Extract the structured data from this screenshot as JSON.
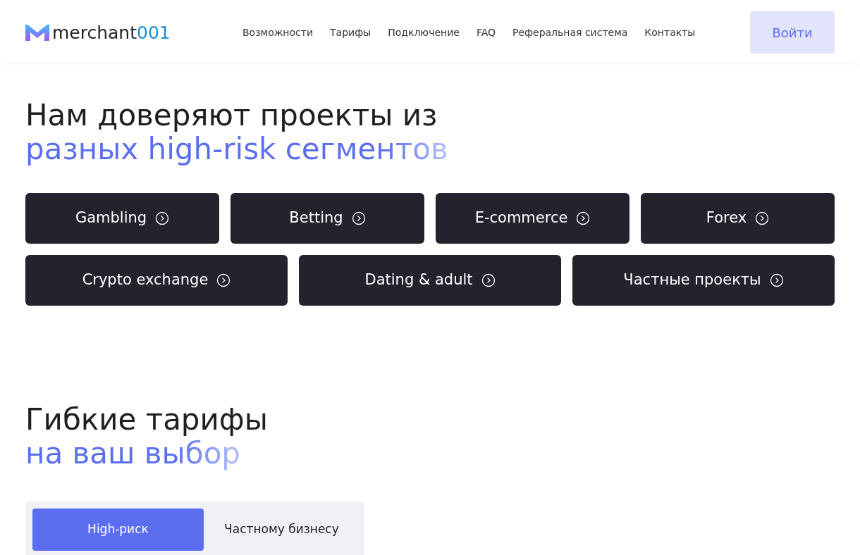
{
  "header": {
    "logo": {
      "name": "merchant",
      "suffix": "001"
    },
    "nav": [
      "Возможности",
      "Тарифы",
      "Подключение",
      "FAQ",
      "Реферальная система",
      "Контакты"
    ],
    "login_button": "Войти"
  },
  "trust_section": {
    "title": "Нам доверяют проекты из",
    "subtitle": "разных high-risk сегментов",
    "segments": [
      {
        "label": "Gambling"
      },
      {
        "label": "Betting"
      },
      {
        "label": "E-commerce"
      },
      {
        "label": "Forex"
      },
      {
        "label": "Crypto exchange"
      },
      {
        "label": "Dating & adult"
      },
      {
        "label": "Частные проекты"
      }
    ]
  },
  "pricing_section": {
    "title": "Гибкие тарифы",
    "subtitle": "на ваш выбор",
    "tabs": [
      {
        "label": "High-риск",
        "selected": true
      },
      {
        "label": "Частному бизнесу",
        "selected": false
      }
    ]
  }
}
